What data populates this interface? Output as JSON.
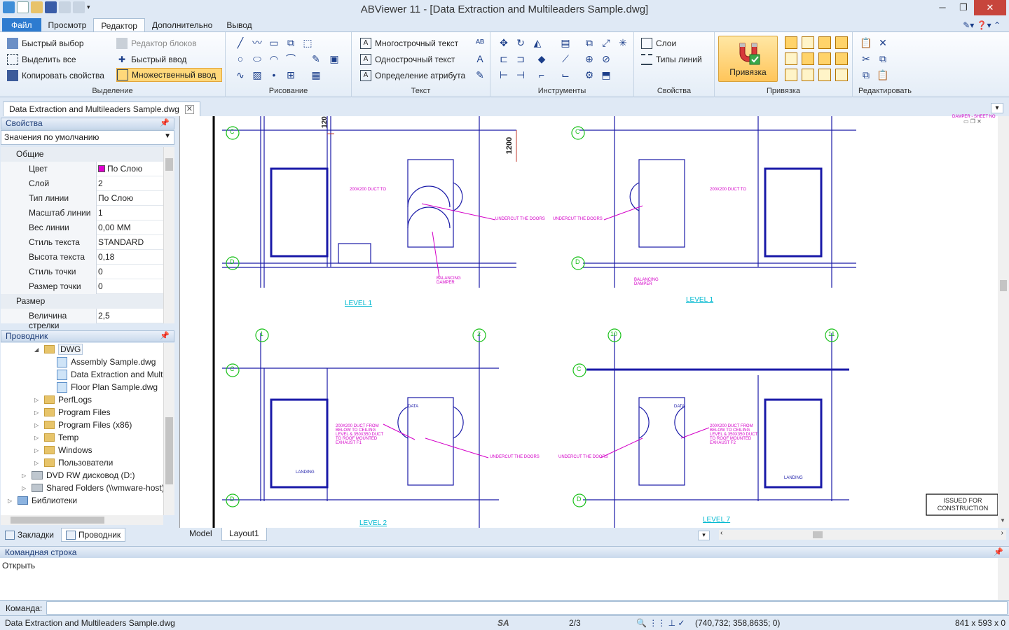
{
  "app": {
    "title": "ABViewer 11 - [Data Extraction and Multileaders Sample.dwg]"
  },
  "ribbon_tabs": [
    "Файл",
    "Просмотр",
    "Редактор",
    "Дополнительно",
    "Вывод"
  ],
  "groups": {
    "selection": {
      "label": "Выделение",
      "quick_select": "Быстрый выбор",
      "select_all": "Выделить все",
      "copy_props": "Копировать свойства",
      "block_editor": "Редактор блоков",
      "quick_input": "Быстрый ввод",
      "multi_input": "Множественный ввод"
    },
    "draw": {
      "label": "Рисование"
    },
    "text": {
      "label": "Текст",
      "mtext": "Многострочный текст",
      "stext": "Однострочный текст",
      "attdef": "Определение атрибута"
    },
    "tools": {
      "label": "Инструменты"
    },
    "props": {
      "label": "Свойства",
      "layers": "Слои",
      "linetypes": "Типы линий"
    },
    "snap": {
      "label": "Привязка",
      "button": "Привязка"
    },
    "edit": {
      "label": "Редактировать"
    }
  },
  "doc_tab": "Data Extraction and Multileaders Sample.dwg",
  "properties": {
    "header": "Свойства",
    "combo": "Значения по умолчанию",
    "cat_general": "Общие",
    "cat_size": "Размер",
    "rows": [
      {
        "name": "Цвет",
        "value": "По Слою"
      },
      {
        "name": "Слой",
        "value": "2"
      },
      {
        "name": "Тип линии",
        "value": "По Слою"
      },
      {
        "name": "Масштаб линии",
        "value": "1"
      },
      {
        "name": "Вес линии",
        "value": "0,00 MM"
      },
      {
        "name": "Стиль текста",
        "value": "STANDARD"
      },
      {
        "name": "Высота текста",
        "value": "0,18"
      },
      {
        "name": "Стиль точки",
        "value": "0"
      },
      {
        "name": "Размер точки",
        "value": "0"
      }
    ],
    "size_rows": [
      {
        "name": "Величина стрелки",
        "value": "2,5"
      }
    ]
  },
  "explorer": {
    "header": "Проводник",
    "items": [
      "DWG",
      "Assembly Sample.dwg",
      "Data Extraction and Mult",
      "Floor Plan Sample.dwg",
      "PerfLogs",
      "Program Files",
      "Program Files (x86)",
      "Temp",
      "Windows",
      "Пользователи",
      "DVD RW дисковод (D:)",
      "Shared Folders (\\\\vmware-host)",
      "Библиотеки"
    ]
  },
  "bottom_tabs": [
    "Закладки",
    "Проводник"
  ],
  "layout_tabs": [
    "Model",
    "Layout1"
  ],
  "drawing": {
    "grid": [
      "C",
      "D",
      "1",
      "2",
      "10",
      "11"
    ],
    "levels": [
      "LEVEL 1",
      "LEVEL 2",
      "LEVEL 7"
    ],
    "dims": [
      "1200",
      "120"
    ],
    "notes": [
      "UNDERCUT THE DOORS",
      "BALANCING DAMPER",
      "200X200 DUCT TO",
      "200X200 DUCT FROM BELOW TO CEILING LEVEL & 350X350 DUCT TO ROOF MOUNTED EXHAUST F1",
      "200X200 DUCT FROM BELOW TO CEILING LEVEL & 350X350 DUCT TO ROOF MOUNTED EXHAUST F2",
      "DATA",
      "LANDING"
    ],
    "stamp_line1": "ISSUED FOR",
    "stamp_line2": "CONSTRUCTION",
    "top_right_label": "DAMPER - SHEET NO"
  },
  "command": {
    "header": "Командная строка",
    "history": "Открыть",
    "prompt": "Команда:"
  },
  "status": {
    "file": "Data Extraction and Multileaders Sample.dwg",
    "sa": "SA",
    "pages": "2/3",
    "coords": "(740,732; 358,8635; 0)",
    "size": "841 x 593 x 0"
  },
  "colors": {
    "drawing_lines": "#1a1aa8",
    "annotations": "#d400c8",
    "grid_bubbles": "#18c018",
    "level_labels": "#00b8d0",
    "ribbon_highlight": "#ffd36a",
    "file_tab": "#2d7bd0"
  }
}
